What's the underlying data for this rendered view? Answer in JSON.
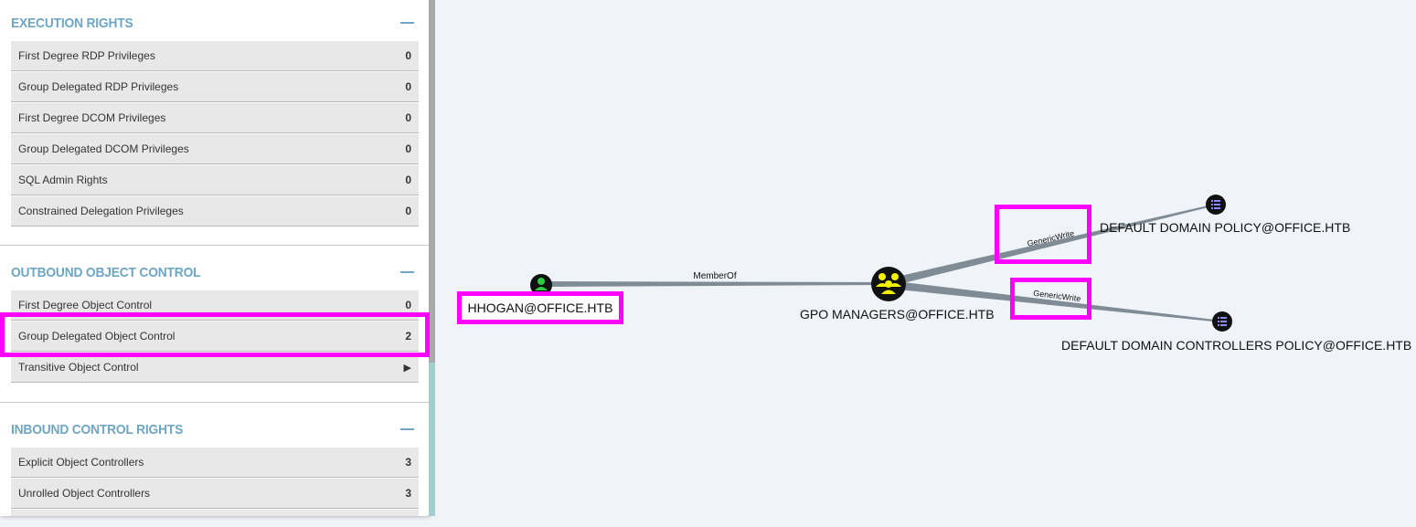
{
  "sections": [
    {
      "title": "EXECUTION RIGHTS",
      "rows": [
        {
          "label": "First Degree RDP Privileges",
          "count": "0"
        },
        {
          "label": "Group Delegated RDP Privileges",
          "count": "0"
        },
        {
          "label": "First Degree DCOM Privileges",
          "count": "0"
        },
        {
          "label": "Group Delegated DCOM Privileges",
          "count": "0"
        },
        {
          "label": "SQL Admin Rights",
          "count": "0"
        },
        {
          "label": "Constrained Delegation Privileges",
          "count": "0"
        }
      ]
    },
    {
      "title": "OUTBOUND OBJECT CONTROL",
      "rows": [
        {
          "label": "First Degree Object Control",
          "count": "0"
        },
        {
          "label": "Group Delegated Object Control",
          "count": "2"
        },
        {
          "label": "Transitive Object Control",
          "count": "▶"
        }
      ]
    },
    {
      "title": "INBOUND CONTROL RIGHTS",
      "rows": [
        {
          "label": "Explicit Object Controllers",
          "count": "3"
        },
        {
          "label": "Unrolled Object Controllers",
          "count": "3"
        }
      ]
    }
  ],
  "graph": {
    "nodes": {
      "user": {
        "label": "HHOGAN@OFFICE.HTB",
        "icon": "user-icon"
      },
      "group": {
        "label": "GPO MANAGERS@OFFICE.HTB",
        "icon": "group-icon"
      },
      "gpo1": {
        "label": "DEFAULT DOMAIN POLICY@OFFICE.HTB",
        "icon": "gpo-icon"
      },
      "gpo2": {
        "label": "DEFAULT DOMAIN CONTROLLERS POLICY@OFFICE.HTB",
        "icon": "gpo-icon"
      }
    },
    "edges": {
      "memberof": "MemberOf",
      "genericwrite1": "GenericWrite",
      "genericwrite2": "GenericWrite"
    }
  },
  "colors": {
    "accent": "#6fa6c4",
    "highlight": "#ff00ff",
    "edge": "#7f8c96",
    "group_node": "#f0f000",
    "user_node": "#2ecc40"
  }
}
